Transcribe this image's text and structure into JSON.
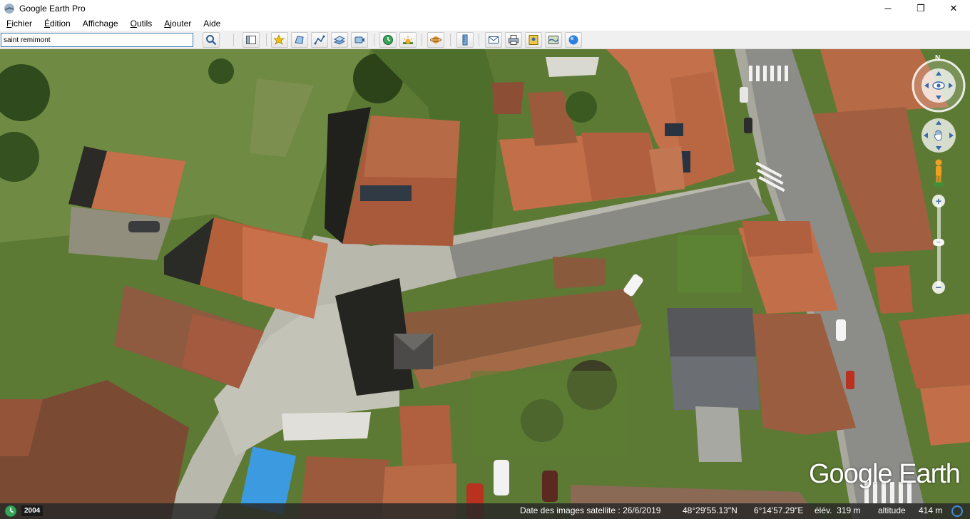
{
  "window": {
    "title": "Google Earth Pro",
    "minimize_glyph": "─",
    "maximize_glyph": "❐",
    "close_glyph": "✕"
  },
  "menu": {
    "items": [
      {
        "accel": "F",
        "rest": "ichier"
      },
      {
        "accel": "É",
        "rest": "dition"
      },
      {
        "accel": "",
        "rest": "Affichage"
      },
      {
        "accel": "O",
        "rest": "utils"
      },
      {
        "accel": "A",
        "rest": "jouter"
      },
      {
        "accel": "",
        "rest": "Aide"
      }
    ]
  },
  "search": {
    "value": "saint remimont"
  },
  "toolbar": {
    "buttons": [
      "search-icon",
      "sidebar-icon",
      "placemark-icon",
      "polygon-icon",
      "path-icon",
      "image-overlay-icon",
      "record-tour-icon",
      "historical-imagery-icon",
      "sunlight-icon",
      "planets-icon",
      "ruler-icon",
      "email-icon",
      "print-icon",
      "save-image-icon",
      "map-view-icon",
      "google-maps-icon"
    ]
  },
  "navigation": {
    "north_label": "N",
    "zoom_in": "+",
    "zoom_out": "−"
  },
  "logo": "Google Earth",
  "status": {
    "year": "2004",
    "imagery_date": "Date des images satellite : 26/6/2019",
    "latitude": "48°29'55.13\"N",
    "longitude": "6°14'57.29\"E",
    "elevation": "élév.  319 m",
    "altitude_label": "altitude",
    "altitude_value": "414 m"
  },
  "colors": {
    "roof": "#b9623e",
    "grass": "#4f7a2c",
    "road": "#7d7d78",
    "pavement": "#c9c8bd",
    "accent_blue": "#3b6aa8"
  }
}
